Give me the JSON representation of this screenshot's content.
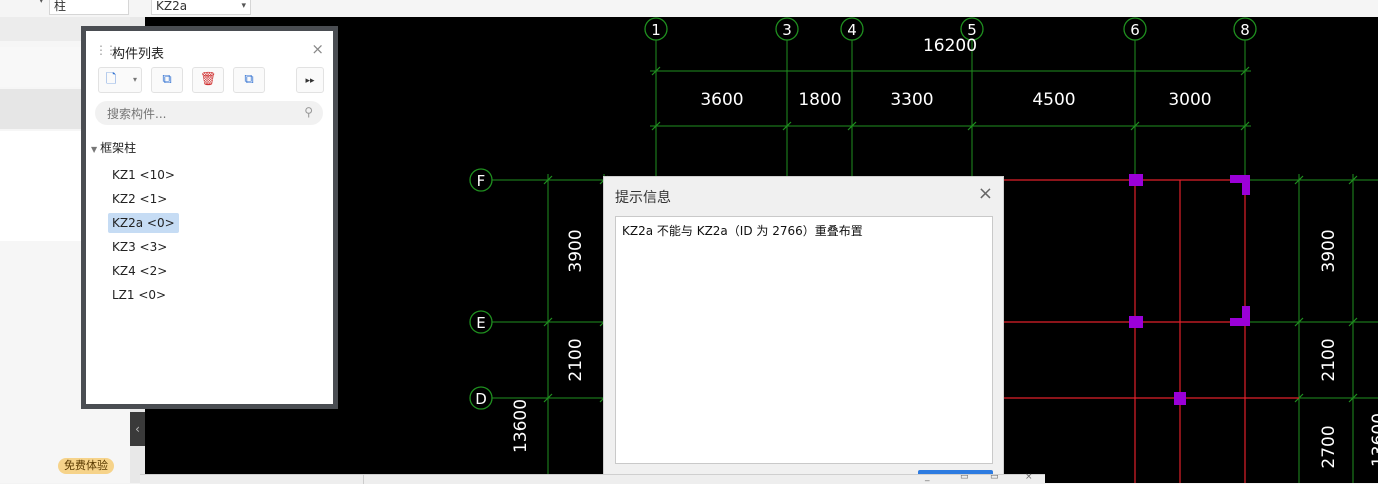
{
  "topbar": {
    "combo1_value": "柱",
    "combo2_value": "KZ2a"
  },
  "badge": {
    "trial_label": "免费体验"
  },
  "component_list": {
    "title": "构件列表",
    "search_placeholder": "搜索构件...",
    "group_label": "框架柱",
    "items": [
      {
        "label": "KZ1 <10>",
        "selected": false
      },
      {
        "label": "KZ2 <1>",
        "selected": false
      },
      {
        "label": "KZ2a <0>",
        "selected": true
      },
      {
        "label": "KZ3 <3>",
        "selected": false
      },
      {
        "label": "KZ4 <2>",
        "selected": false
      },
      {
        "label": "LZ1 <0>",
        "selected": false
      }
    ]
  },
  "drawing": {
    "axes_top": [
      "1",
      "3",
      "4",
      "5",
      "6",
      "8"
    ],
    "axes_left": [
      "F",
      "E",
      "D"
    ],
    "total_dim_top": "16200",
    "dims_top": [
      "3600",
      "1800",
      "3300",
      "4500",
      "3000"
    ],
    "dims_left": [
      "3900",
      "2100"
    ],
    "dims_right": [
      "3900",
      "2100",
      "2700"
    ],
    "total_dim_left": "13600",
    "total_dim_right_partial": "13600"
  },
  "dialog": {
    "title": "提示信息",
    "message": "KZ2a 不能与 KZ2a（ID 为 2766）重叠布置"
  },
  "colors": {
    "canvas_bg": "#000000",
    "axis_line": "#1f8f1f",
    "beam_line": "#e0202a",
    "column": "#9b00d8",
    "selection": "#c6dcf4"
  }
}
